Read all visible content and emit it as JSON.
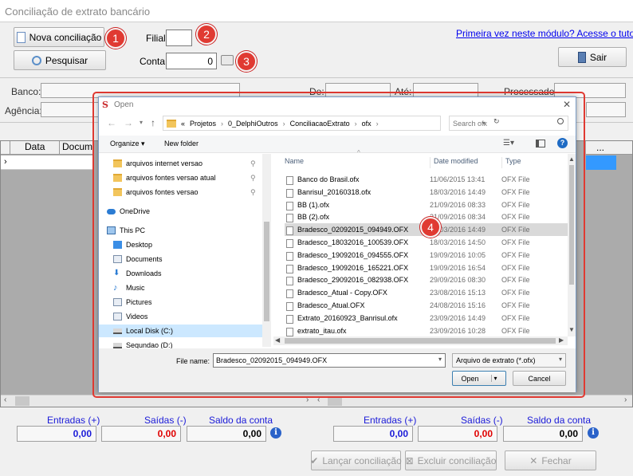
{
  "window": {
    "title": "Conciliação de extrato bancário"
  },
  "toolbar": {
    "nova_conciliacao": "Nova conciliação",
    "pesquisar": "Pesquisar",
    "filial_label": "Filial:",
    "filial_value": "",
    "conta_label": "Conta:",
    "conta_value": "0",
    "help_link": "Primeira vez neste módulo? Acesse o tutorial",
    "sair": "Sair"
  },
  "badges": [
    "1",
    "2",
    "3",
    "4"
  ],
  "info": {
    "banco_label": "Banco:",
    "agencia_label": "Agência:",
    "de_label": "De:",
    "ate_label": "Até:",
    "processado_label": "Processado:"
  },
  "grid": {
    "columns": [
      "Data",
      "Docum"
    ],
    "right_columns": [
      "..."
    ]
  },
  "totals": {
    "left": {
      "entradas_label": "Entradas (+)",
      "saidas_label": "Saídas (-)",
      "saldo_label": "Saldo da conta",
      "entradas": "0,00",
      "saidas": "0,00",
      "saldo": "0,00"
    },
    "right": {
      "entradas_label": "Entradas (+)",
      "saidas_label": "Saídas (-)",
      "saldo_label": "Saldo da conta",
      "entradas": "0,00",
      "saidas": "0,00",
      "saldo": "0,00"
    }
  },
  "footer": {
    "lancar": "Lançar conciliação",
    "excluir": "Excluir conciliação",
    "fechar": "Fechar"
  },
  "colors": {
    "accent_blue": "#1a1ad8",
    "red": "#e00000",
    "highlight": "#e03a32"
  },
  "dialog": {
    "title": "Open",
    "breadcrumb": [
      "«",
      "Projetos",
      "0_DelphiOutros",
      "ConciliacaoExtrato",
      "ofx"
    ],
    "search_placeholder": "Search ofx",
    "organize": "Organize ▾",
    "new_folder": "New folder",
    "nav": [
      {
        "label": "arquivos internet versao",
        "icon": "folder-icon",
        "pinned": true
      },
      {
        "label": "arquivos fontes versao atual",
        "icon": "folder-icon",
        "pinned": true
      },
      {
        "label": "arquivos fontes versao",
        "icon": "folder-icon",
        "pinned": true
      },
      {
        "label": "OneDrive",
        "icon": "cloud-icon",
        "pinned": false
      },
      {
        "label": "This PC",
        "icon": "computer-icon",
        "pinned": false
      },
      {
        "label": "Desktop",
        "icon": "desktop-icon",
        "pinned": false
      },
      {
        "label": "Documents",
        "icon": "documents-icon",
        "pinned": false
      },
      {
        "label": "Downloads",
        "icon": "download-icon",
        "pinned": false
      },
      {
        "label": "Music",
        "icon": "music-icon",
        "pinned": false
      },
      {
        "label": "Pictures",
        "icon": "pictures-icon",
        "pinned": false
      },
      {
        "label": "Videos",
        "icon": "videos-icon",
        "pinned": false
      },
      {
        "label": "Local Disk (C:)",
        "icon": "drive-icon",
        "pinned": false
      },
      {
        "label": "Sequndao (D:)",
        "icon": "drive-icon",
        "pinned": false
      }
    ],
    "columns": {
      "name": "Name",
      "date": "Date modified",
      "type": "Type"
    },
    "files": [
      {
        "name": "Banco do Brasil.ofx",
        "date": "11/06/2015 13:41",
        "type": "OFX File"
      },
      {
        "name": "Banrisul_20160318.ofx",
        "date": "18/03/2016 14:49",
        "type": "OFX File"
      },
      {
        "name": "BB (1).ofx",
        "date": "21/09/2016 08:33",
        "type": "OFX File"
      },
      {
        "name": "BB (2).ofx",
        "date": "21/09/2016 08:34",
        "type": "OFX File"
      },
      {
        "name": "Bradesco_02092015_094949.OFX",
        "date": "18/03/2016 14:49",
        "type": "OFX File",
        "selected": true
      },
      {
        "name": "Bradesco_18032016_100539.OFX",
        "date": "18/03/2016 14:50",
        "type": "OFX File"
      },
      {
        "name": "Bradesco_19092016_094555.OFX",
        "date": "19/09/2016 10:05",
        "type": "OFX File"
      },
      {
        "name": "Bradesco_19092016_165221.OFX",
        "date": "19/09/2016 16:54",
        "type": "OFX File"
      },
      {
        "name": "Bradesco_29092016_082938.OFX",
        "date": "29/09/2016 08:30",
        "type": "OFX File"
      },
      {
        "name": "Bradesco_Atual - Copy.OFX",
        "date": "23/08/2016 15:13",
        "type": "OFX File"
      },
      {
        "name": "Bradesco_Atual.OFX",
        "date": "24/08/2016 15:16",
        "type": "OFX File"
      },
      {
        "name": "Extrato_20160923_Banrisul.ofx",
        "date": "23/09/2016 14:49",
        "type": "OFX File"
      },
      {
        "name": "extrato_itau.ofx",
        "date": "23/09/2016 10:28",
        "type": "OFX File"
      }
    ],
    "filename_label": "File name:",
    "filename_value": "Bradesco_02092015_094949.OFX",
    "filter": "Arquivo de extrato (*.ofx)",
    "open": "Open",
    "cancel": "Cancel"
  }
}
